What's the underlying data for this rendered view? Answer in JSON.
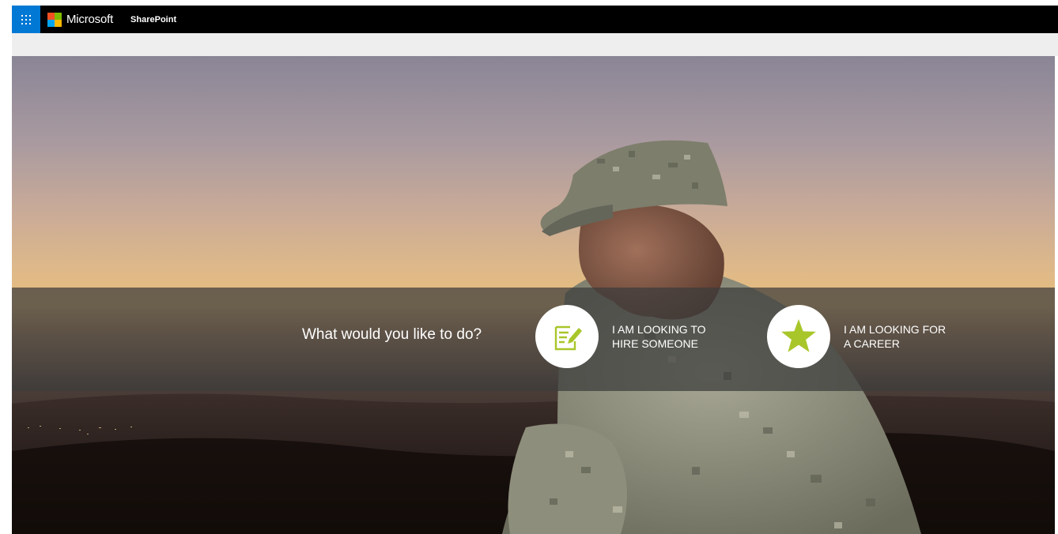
{
  "suite_bar": {
    "waffle_icon": "app-launcher-icon",
    "brand": "Microsoft",
    "logo_colors": [
      "#f25022",
      "#7fba00",
      "#00a4ef",
      "#ffb900"
    ],
    "app_name": "SharePoint",
    "accent": "#0078d4"
  },
  "hero": {
    "prompt": "What would you like to do?",
    "options": [
      {
        "icon": "edit-document-icon",
        "line1": "I AM LOOKING TO",
        "line2": "HIRE SOMEONE"
      },
      {
        "icon": "star-icon",
        "line1": "I AM LOOKING FOR",
        "line2": "A CAREER"
      }
    ],
    "icon_color": "#a8c62a"
  }
}
